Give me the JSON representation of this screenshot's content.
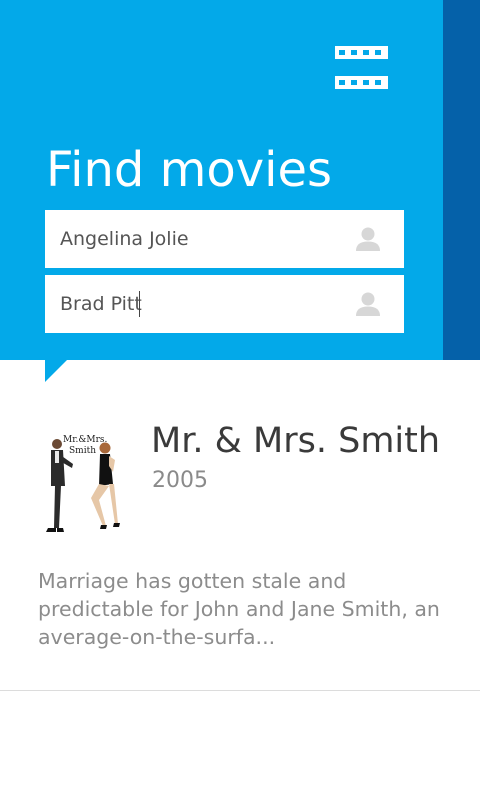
{
  "header": {
    "title": "Find movies",
    "icon": "film-strip-icon",
    "colors": {
      "header_bg": "#03a9e9",
      "side_strip": "#0561a9"
    }
  },
  "search": {
    "actor_one": {
      "value": "Angelina Jolie",
      "icon": "person-icon"
    },
    "actor_two": {
      "value": "Brad Pitt",
      "icon": "person-icon"
    }
  },
  "result": {
    "title": "Mr. & Mrs. Smith",
    "year": "2005",
    "overview": "Marriage has gotten stale and predictable for John and Jane Smith, an average-on-the-surfa...",
    "poster_text": "Mr.&Mrs. Smith"
  }
}
